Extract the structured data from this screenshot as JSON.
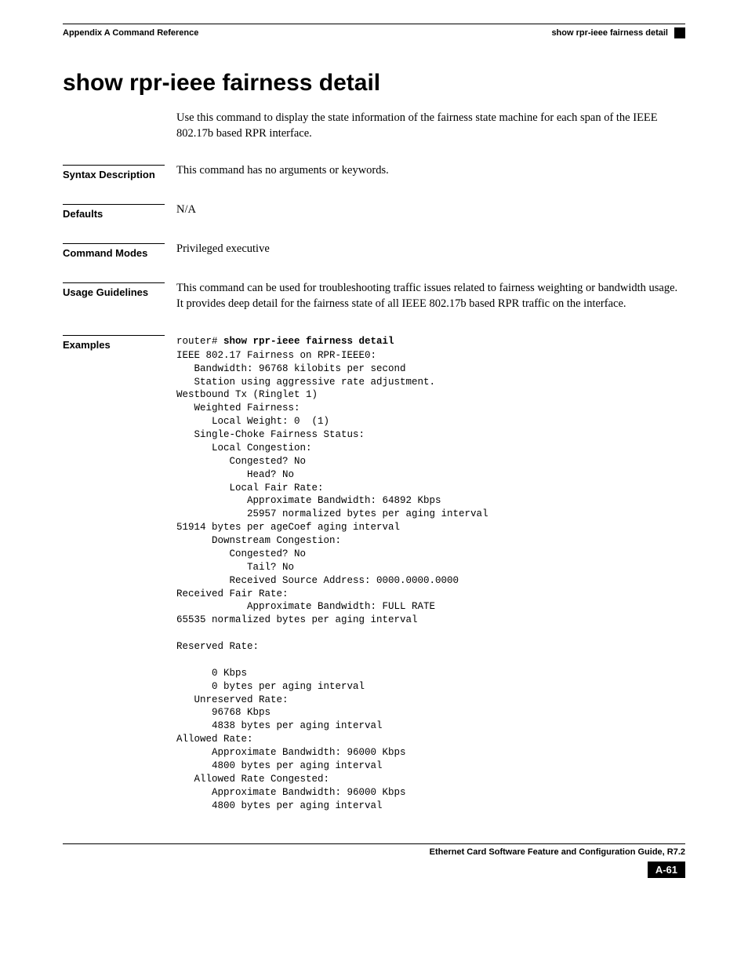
{
  "header": {
    "appendix": "Appendix A Command Reference",
    "topic": "show rpr-ieee fairness detail"
  },
  "title": "show rpr-ieee fairness detail",
  "intro": "Use this command to display the state information of the fairness state machine for each span of the IEEE 802.17b based RPR interface.",
  "sections": {
    "syntax": {
      "label": "Syntax Description",
      "text": "This command has no arguments or keywords."
    },
    "defaults": {
      "label": "Defaults",
      "text": "N/A"
    },
    "modes": {
      "label": "Command Modes",
      "text": "Privileged executive"
    },
    "usage": {
      "label": "Usage Guidelines",
      "text": "This command can be used for troubleshooting traffic issues related to fairness weighting or bandwidth usage. It provides deep detail for the fairness state of all IEEE 802.17b based RPR traffic on the interface."
    },
    "examples": {
      "label": "Examples",
      "prompt": "router# ",
      "command": "show rpr-ieee fairness detail",
      "output": "IEEE 802.17 Fairness on RPR-IEEE0:\n   Bandwidth: 96768 kilobits per second\n   Station using aggressive rate adjustment.\nWestbound Tx (Ringlet 1)\n   Weighted Fairness:\n      Local Weight: 0  (1)\n   Single-Choke Fairness Status:\n      Local Congestion:\n         Congested? No\n            Head? No\n         Local Fair Rate:\n            Approximate Bandwidth: 64892 Kbps\n            25957 normalized bytes per aging interval\n51914 bytes per ageCoef aging interval\n      Downstream Congestion:\n         Congested? No\n            Tail? No\n         Received Source Address: 0000.0000.0000\nReceived Fair Rate:\n            Approximate Bandwidth: FULL RATE\n65535 normalized bytes per aging interval\n\nReserved Rate:\n\n      0 Kbps\n      0 bytes per aging interval\n   Unreserved Rate:\n      96768 Kbps\n      4838 bytes per aging interval\nAllowed Rate:\n      Approximate Bandwidth: 96000 Kbps\n      4800 bytes per aging interval\n   Allowed Rate Congested:\n      Approximate Bandwidth: 96000 Kbps\n      4800 bytes per aging interval"
    }
  },
  "footer": {
    "guide": "Ethernet Card Software Feature and Configuration Guide, R7.2",
    "page": "A-61"
  }
}
